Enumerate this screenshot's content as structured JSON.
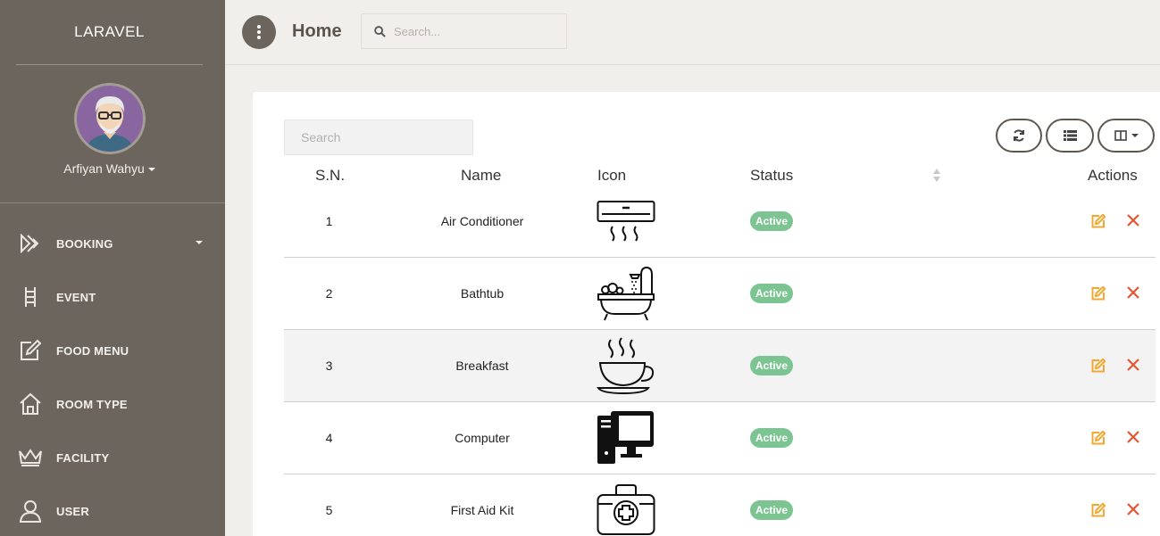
{
  "brand": "LARAVEL",
  "user": {
    "name": "Arfiyan Wahyu"
  },
  "nav": [
    {
      "label": "BOOKING",
      "icon": "forward-arrows-icon",
      "has_caret": true
    },
    {
      "label": "EVENT",
      "icon": "ladder-icon",
      "has_caret": false
    },
    {
      "label": "FOOD MENU",
      "icon": "edit-note-icon",
      "has_caret": false
    },
    {
      "label": "ROOM TYPE",
      "icon": "home-icon",
      "has_caret": false
    },
    {
      "label": "FACILITY",
      "icon": "crown-icon",
      "has_caret": false
    },
    {
      "label": "USER",
      "icon": "user-icon",
      "has_caret": false
    }
  ],
  "header": {
    "title": "Home",
    "search_placeholder": "Search..."
  },
  "table": {
    "search_placeholder": "Search",
    "columns": {
      "sn": "S.N.",
      "name": "Name",
      "icon": "Icon",
      "status": "Status",
      "actions": "Actions"
    },
    "rows": [
      {
        "sn": "1",
        "name": "Air Conditioner",
        "icon": "air-conditioner-icon",
        "status": "Active"
      },
      {
        "sn": "2",
        "name": "Bathtub",
        "icon": "bathtub-icon",
        "status": "Active"
      },
      {
        "sn": "3",
        "name": "Breakfast",
        "icon": "coffee-cup-icon",
        "status": "Active"
      },
      {
        "sn": "4",
        "name": "Computer",
        "icon": "computer-icon",
        "status": "Active"
      },
      {
        "sn": "5",
        "name": "First Aid Kit",
        "icon": "first-aid-kit-icon",
        "status": "Active"
      }
    ]
  },
  "colors": {
    "sidebar": "#6c655d",
    "badge": "#7cc492",
    "edit": "#f0a830",
    "delete": "#e8542e"
  }
}
